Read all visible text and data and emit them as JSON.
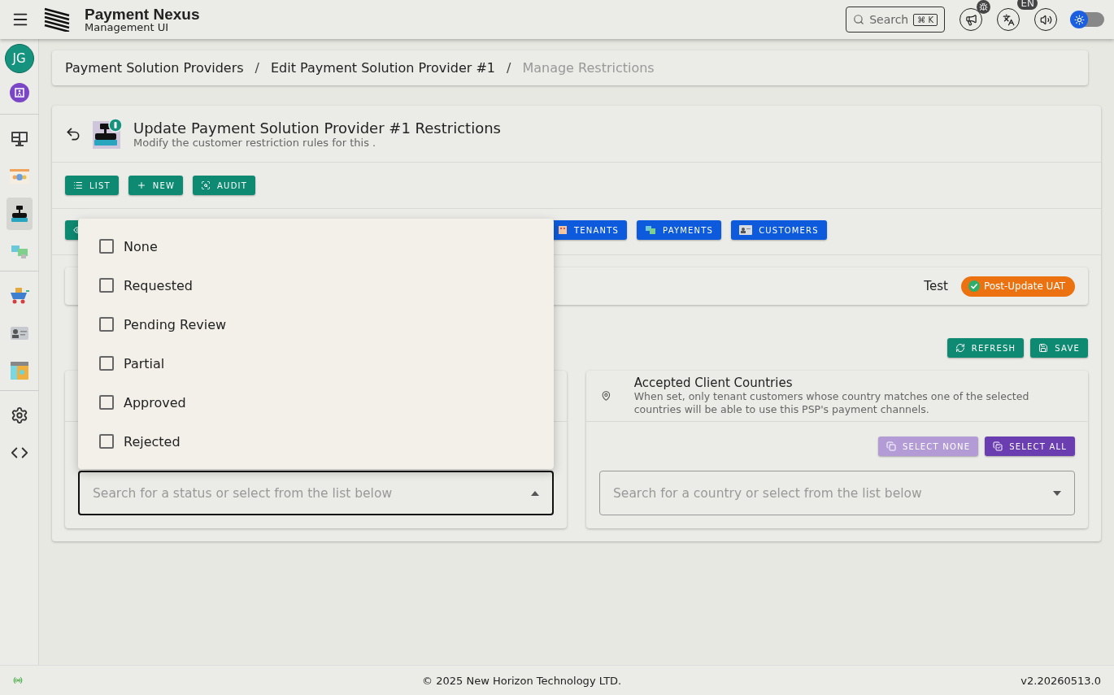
{
  "header": {
    "title": "Payment Nexus",
    "subtitle": "Management UI",
    "search": {
      "placeholder": "Search",
      "shortcut": "⌘ K"
    },
    "language_badge": "EN",
    "theme_toggle": {
      "on": false
    }
  },
  "sidebar": {
    "avatar": "JG",
    "items": [
      {
        "kind": "monitor",
        "selected": false
      },
      {
        "kind": "gears-banner",
        "selected": false
      },
      {
        "kind": "cash-register",
        "selected": true
      },
      {
        "kind": "transfer",
        "selected": false
      },
      {
        "kind": "cart",
        "selected": false
      },
      {
        "kind": "id-card",
        "selected": false
      },
      {
        "kind": "ledger",
        "selected": false
      },
      {
        "kind": "settings",
        "selected": false
      },
      {
        "kind": "code",
        "selected": false
      }
    ]
  },
  "breadcrumbs": [
    {
      "label": "Payment Solution Providers",
      "current": false
    },
    {
      "label": "Edit Payment Solution Provider #1",
      "current": false
    },
    {
      "label": "Manage Restrictions",
      "current": true
    }
  ],
  "page": {
    "title": "Update Payment Solution Provider #1 Restrictions",
    "subtitle": "Modify the customer restriction rules for this ."
  },
  "actions": [
    {
      "label": "LIST",
      "kind": "list"
    },
    {
      "label": "NEW",
      "kind": "new"
    },
    {
      "label": "AUDIT",
      "kind": "audit"
    }
  ],
  "breadcrumb_separators": [
    "/",
    "/"
  ],
  "related_tabs": [
    {
      "kind": "view",
      "selected": true
    },
    {
      "kind": "tenants",
      "label": "TENANTS",
      "selected": false
    },
    {
      "kind": "payments",
      "label": "PAYMENTS",
      "selected": false
    },
    {
      "kind": "customers",
      "label": "CUSTOMERS",
      "selected": false
    }
  ],
  "environment": {
    "name": "Test",
    "badge": "Post-Update UAT"
  },
  "toolbar": [
    {
      "label": "REFRESH",
      "kind": "refresh"
    },
    {
      "label": "SAVE",
      "kind": "save"
    }
  ],
  "status_card": {
    "field": {
      "placeholder": "Search for a status or select from the list below",
      "expanded": true
    },
    "options": [
      {
        "label": "None",
        "checked": false
      },
      {
        "label": "Requested",
        "checked": false
      },
      {
        "label": "Pending Review",
        "checked": false
      },
      {
        "label": "Partial",
        "checked": false
      },
      {
        "label": "Approved",
        "checked": false
      },
      {
        "label": "Rejected",
        "checked": false
      }
    ]
  },
  "countries_card": {
    "title": "Accepted Client Countries",
    "description": "When set, only tenant customers whose country matches one of the selected countries will be able to use this PSP's payment channels.",
    "buttons": [
      {
        "label": "SELECT NONE",
        "kind": "none",
        "disabled": true
      },
      {
        "label": "SELECT ALL",
        "kind": "all",
        "disabled": false
      }
    ],
    "field": {
      "placeholder": "Search for a country or select from the list below",
      "expanded": false
    }
  },
  "footer": {
    "copyright": "© 2025 New Horizon Technology LTD.",
    "version": "v2.20260513.0"
  }
}
